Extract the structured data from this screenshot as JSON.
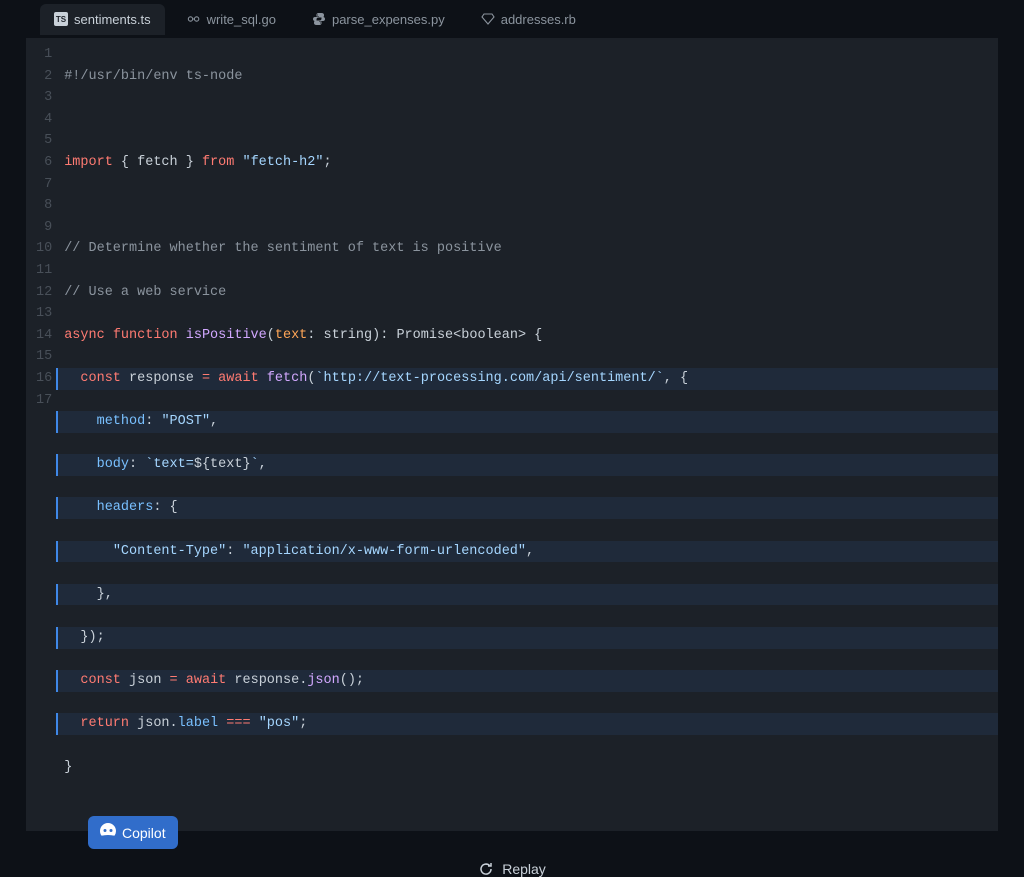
{
  "tabs": [
    {
      "label": "sentiments.ts",
      "icon": "ts-icon",
      "active": true
    },
    {
      "label": "write_sql.go",
      "icon": "go-icon",
      "active": false
    },
    {
      "label": "parse_expenses.py",
      "icon": "python-icon",
      "active": false
    },
    {
      "label": "addresses.rb",
      "icon": "ruby-icon",
      "active": false
    }
  ],
  "line_numbers": [
    "1",
    "2",
    "3",
    "4",
    "5",
    "6",
    "7",
    "8",
    "9",
    "10",
    "11",
    "12",
    "13",
    "14",
    "15",
    "16",
    "17"
  ],
  "code": {
    "l1": {
      "shebang": "#!/usr/bin/env ts-node"
    },
    "l3": {
      "kw_import": "import",
      "braces_open": "{ ",
      "ident": "fetch",
      "braces_close": " }",
      "kw_from": "from",
      "str": "\"fetch-h2\"",
      "semi": ";"
    },
    "l5": {
      "comment": "// Determine whether the sentiment of text is positive"
    },
    "l6": {
      "comment": "// Use a web service"
    },
    "l7": {
      "kw_async": "async",
      "kw_function": "function",
      "fn": "isPositive",
      "p_open": "(",
      "param": "text",
      "colon": ":",
      "type": "string",
      "p_close": ")",
      "ret_colon": ":",
      "ret_type": "Promise<boolean>",
      "brace": " {"
    },
    "l8": {
      "kw_const": "const",
      "var": "response",
      "eq": "=",
      "kw_await": "await",
      "fn": "fetch",
      "p_open": "(",
      "str": "`http://text-processing.com/api/sentiment/`",
      "comma": ",",
      "brace": " {"
    },
    "l9": {
      "prop": "method",
      "colon": ":",
      "str": "\"POST\"",
      "comma": ","
    },
    "l10": {
      "prop": "body",
      "colon": ":",
      "str_open": "`text=",
      "interp_open": "${",
      "ident": "text",
      "interp_close": "}",
      "str_close": "`",
      "comma": ","
    },
    "l11": {
      "prop": "headers",
      "colon": ":",
      "brace": " {"
    },
    "l12": {
      "str_key": "\"Content-Type\"",
      "colon": ":",
      "str_val": "\"application/x-www-form-urlencoded\"",
      "comma": ","
    },
    "l13": {
      "brace_close": "}",
      "comma": ","
    },
    "l14": {
      "brace_close": "});"
    },
    "l15": {
      "kw_const": "const",
      "var": "json",
      "eq": "=",
      "kw_await": "await",
      "obj": "response",
      "dot": ".",
      "method": "json",
      "call": "();"
    },
    "l16": {
      "kw_return": "return",
      "obj": "json",
      "dot": ".",
      "prop": "label",
      "eqeqeq": "===",
      "str": "\"pos\"",
      "semi": ";"
    },
    "l17": {
      "brace_close": "}"
    }
  },
  "copilot_label": "Copilot",
  "replay_label": "Replay"
}
